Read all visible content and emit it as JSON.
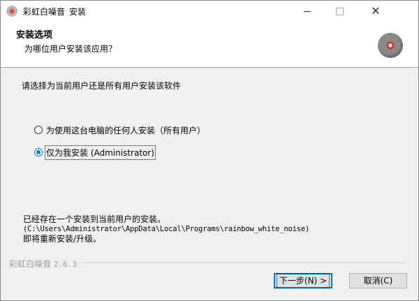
{
  "window": {
    "app_name": "彩虹白噪音",
    "title_suffix": "安装",
    "controls": {
      "minimize": "minimize-icon",
      "maximize": "maximize-icon",
      "close": "✕"
    }
  },
  "header": {
    "title": "安装选项",
    "subtitle": "为哪位用户安装该应用？",
    "icon": "app-logo-icon"
  },
  "body": {
    "instruction": "请选择为当前用户还是所有用户安装该软件",
    "options": [
      {
        "label": "为使用这台电脑的任何人安装（所有用户）",
        "checked": false
      },
      {
        "label": "仅为我安装 (Administrator)",
        "checked": true
      }
    ],
    "notice": {
      "line1": "已经存在一个安装到当前用户的安装。",
      "line2": "(C:\\Users\\Administrator\\AppData\\Local\\Programs\\rainbow_white_noise)",
      "line3": "即将重新安装/升级。"
    }
  },
  "footer": {
    "brand": "彩虹白噪音",
    "version": "2.6.3",
    "next_label": "下一步(N) >",
    "cancel_label": "取消(C)"
  },
  "colors": {
    "accent": "#0078d7",
    "window_bg": "#f0f0f0",
    "header_bg": "#ffffff"
  }
}
